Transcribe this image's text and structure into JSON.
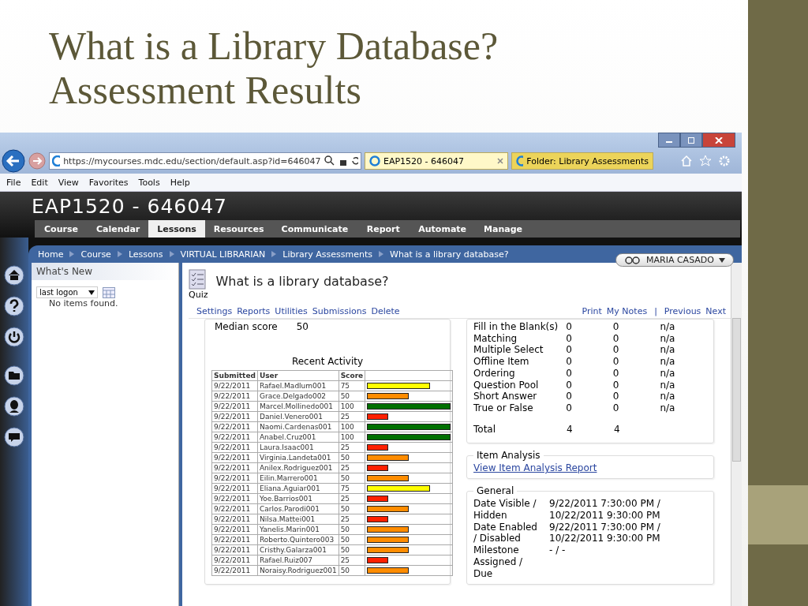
{
  "slide_title": [
    "What is a Library Database?",
    "Assessment Results"
  ],
  "browser": {
    "address": "https://mycourses.mdc.edu/section/default.asp?id=646047",
    "tabs": [
      {
        "label": "EAP1520 - 646047",
        "selected": true
      },
      {
        "label": "Folder: Library Assessments",
        "selected": false
      }
    ],
    "menu": [
      "File",
      "Edit",
      "View",
      "Favorites",
      "Tools",
      "Help"
    ]
  },
  "course_title": "EAP1520 - 646047",
  "nav": [
    {
      "label": "Course",
      "selected": false
    },
    {
      "label": "Calendar",
      "selected": false
    },
    {
      "label": "Lessons",
      "selected": true
    },
    {
      "label": "Resources",
      "selected": false
    },
    {
      "label": "Communicate",
      "selected": false
    },
    {
      "label": "Report",
      "selected": false
    },
    {
      "label": "Automate",
      "selected": false
    },
    {
      "label": "Manage",
      "selected": false
    }
  ],
  "breadcrumb": [
    "Home",
    "Course",
    "Lessons",
    "VIRTUAL LIBRARIAN",
    "Library Assessments",
    "What is a library database?"
  ],
  "user": "MARIA CASADO",
  "sidebar": {
    "title": "What's New",
    "filter": "last logon",
    "empty": "No items found."
  },
  "content": {
    "title": "What is a library database?",
    "type": "Quiz",
    "actions": [
      "Settings",
      "Reports",
      "Utilities",
      "Submissions",
      "Delete"
    ],
    "tools": [
      "Print",
      "My Notes"
    ],
    "separator": "|",
    "pager": [
      "Previous",
      "Next"
    ],
    "median": {
      "label": "Median score",
      "value": "50"
    },
    "recent_activity": {
      "title": "Recent Activity",
      "columns": [
        "Submitted",
        "User",
        "Score"
      ],
      "rows": [
        {
          "submitted": "9/22/2011",
          "user": "Rafael.Madlum001",
          "score": "75",
          "level": 0.75,
          "color": "#ffff00"
        },
        {
          "submitted": "9/22/2011",
          "user": "Grace.Delgado002",
          "score": "50",
          "level": 0.5,
          "color": "#ff8c00"
        },
        {
          "submitted": "9/22/2011",
          "user": "Marcel.Mollinedo001",
          "score": "100",
          "level": 1,
          "color": "#007000"
        },
        {
          "submitted": "9/22/2011",
          "user": "Daniel.Venero001",
          "score": "25",
          "level": 0.25,
          "color": "#ff2000"
        },
        {
          "submitted": "9/22/2011",
          "user": "Naomi.Cardenas001",
          "score": "100",
          "level": 1,
          "color": "#007000"
        },
        {
          "submitted": "9/22/2011",
          "user": "Anabel.Cruz001",
          "score": "100",
          "level": 1,
          "color": "#007000"
        },
        {
          "submitted": "9/22/2011",
          "user": "Laura.Isaac001",
          "score": "25",
          "level": 0.25,
          "color": "#ff2000"
        },
        {
          "submitted": "9/22/2011",
          "user": "Virginia.Landeta001",
          "score": "50",
          "level": 0.5,
          "color": "#ff8c00"
        },
        {
          "submitted": "9/22/2011",
          "user": "Anilex.Rodriguez001",
          "score": "25",
          "level": 0.25,
          "color": "#ff2000"
        },
        {
          "submitted": "9/22/2011",
          "user": "Eilin.Marrero001",
          "score": "50",
          "level": 0.5,
          "color": "#ff8c00"
        },
        {
          "submitted": "9/22/2011",
          "user": "Eliana.Aguiar001",
          "score": "75",
          "level": 0.75,
          "color": "#ffff00"
        },
        {
          "submitted": "9/22/2011",
          "user": "Yoe.Barrios001",
          "score": "25",
          "level": 0.25,
          "color": "#ff2000"
        },
        {
          "submitted": "9/22/2011",
          "user": "Carlos.Parodi001",
          "score": "50",
          "level": 0.5,
          "color": "#ff8c00"
        },
        {
          "submitted": "9/22/2011",
          "user": "Nilsa.Mattei001",
          "score": "25",
          "level": 0.25,
          "color": "#ff2000"
        },
        {
          "submitted": "9/22/2011",
          "user": "Yanelis.Marin001",
          "score": "50",
          "level": 0.5,
          "color": "#ff8c00"
        },
        {
          "submitted": "9/22/2011",
          "user": "Roberto.Quintero003",
          "score": "50",
          "level": 0.5,
          "color": "#ff8c00"
        },
        {
          "submitted": "9/22/2011",
          "user": "Cristhy.Galarza001",
          "score": "50",
          "level": 0.5,
          "color": "#ff8c00"
        },
        {
          "submitted": "9/22/2011",
          "user": "Rafael.Ruiz007",
          "score": "25",
          "level": 0.25,
          "color": "#ff2000"
        },
        {
          "submitted": "9/22/2011",
          "user": "Noraisy.Rodriguez001",
          "score": "50",
          "level": 0.5,
          "color": "#ff8c00"
        }
      ]
    },
    "question_types": {
      "rows": [
        {
          "name": "Fill in the Blank(s)",
          "column_2": "0",
          "column_3": "0",
          "column_4": "n/a"
        },
        {
          "name": "Matching",
          "column_2": "0",
          "column_3": "0",
          "column_4": "n/a"
        },
        {
          "name": "Multiple Select",
          "column_2": "0",
          "column_3": "0",
          "column_4": "n/a"
        },
        {
          "name": "Offline Item",
          "column_2": "0",
          "column_3": "0",
          "column_4": "n/a"
        },
        {
          "name": "Ordering",
          "column_2": "0",
          "column_3": "0",
          "column_4": "n/a"
        },
        {
          "name": "Question Pool",
          "column_2": "0",
          "column_3": "0",
          "column_4": "n/a"
        },
        {
          "name": "Short Answer",
          "column_2": "0",
          "column_3": "0",
          "column_4": "n/a"
        },
        {
          "name": "True or False",
          "column_2": "0",
          "column_3": "0",
          "column_4": "n/a"
        }
      ],
      "total": {
        "name": "Total",
        "column_2": "4",
        "column_3": "4"
      }
    },
    "item_analysis": {
      "title": "Item Analysis",
      "link": "View Item Analysis Report"
    },
    "general": {
      "title": "General",
      "rows": [
        {
          "label": "Date Visible / Hidden",
          "value": "9/22/2011 7:30:00 PM / 10/22/2011 9:30:00 PM"
        },
        {
          "label": "Date Enabled / Disabled",
          "value": "9/22/2011 7:30:00 PM / 10/22/2011 9:30:00 PM"
        },
        {
          "label": "Milestone",
          "value": "- / -"
        },
        {
          "label": "Assigned / Due",
          "value": ""
        }
      ]
    }
  }
}
